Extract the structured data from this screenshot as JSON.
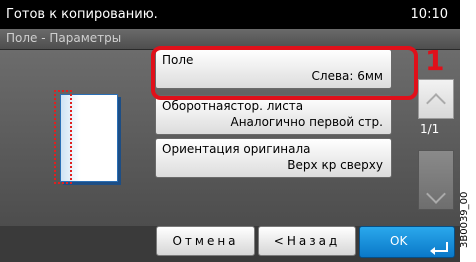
{
  "status": {
    "message": "Готов к копированию.",
    "time": "10:10"
  },
  "title": "Поле - Параметры",
  "options": [
    {
      "label": "Поле",
      "value": "Слева: 6мм"
    },
    {
      "label": "Оборотнаястор. листа",
      "value": "Аналогично первой стр."
    },
    {
      "label": "Ориентация оригинала",
      "value": "Верх кр сверху"
    }
  ],
  "pagination": "1/1",
  "callout": "1",
  "buttons": {
    "cancel": "Отмена",
    "back": "<Назад",
    "ok": "OK"
  },
  "side_code": "3B0039_00",
  "colors": {
    "highlight": "#e0101a",
    "ok": "#0a78c8",
    "preview_border": "#2b6fb5"
  }
}
